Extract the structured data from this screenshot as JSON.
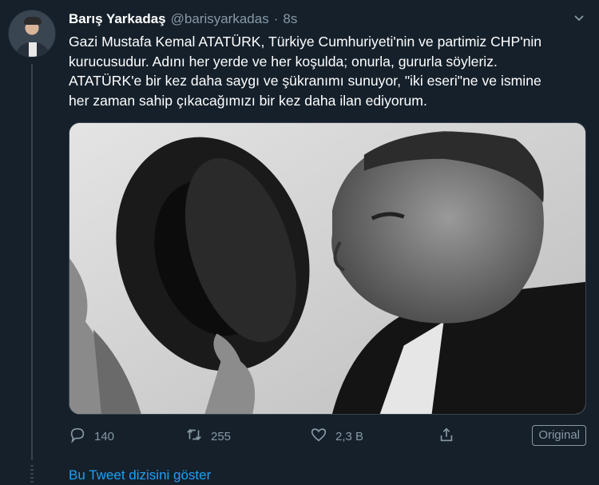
{
  "tweet": {
    "author_name": "Barış Yarkadaş",
    "author_handle": "@barisyarkadas",
    "separator": "·",
    "time": "8s",
    "text_lines": [
      "Gazi Mustafa Kemal ATATÜRK, Türkiye Cumhuriyeti'nin ve partimiz CHP'nin",
      "kurucusudur. Adını her yerde ve her koşulda; onurla, gururla söyleriz.",
      "ATATÜRK'e bir kez daha saygı ve şükranımı sunuyor, \"iki eseri\"ne ve ismine",
      "her zaman sahip çıkacağımızı bir kez daha ilan ediyorum."
    ],
    "menu_icon": "chevron-down-icon",
    "media_icon": "photo"
  },
  "actions": {
    "reply_count": "140",
    "retweet_count": "255",
    "like_count": "2,3 B",
    "original_label": "Original"
  },
  "footer": {
    "show_thread": "Bu Tweet dizisini göster"
  },
  "colors": {
    "background": "#15202b",
    "secondary_text": "#8899a6",
    "link": "#1da1f2",
    "border": "#38444d"
  }
}
